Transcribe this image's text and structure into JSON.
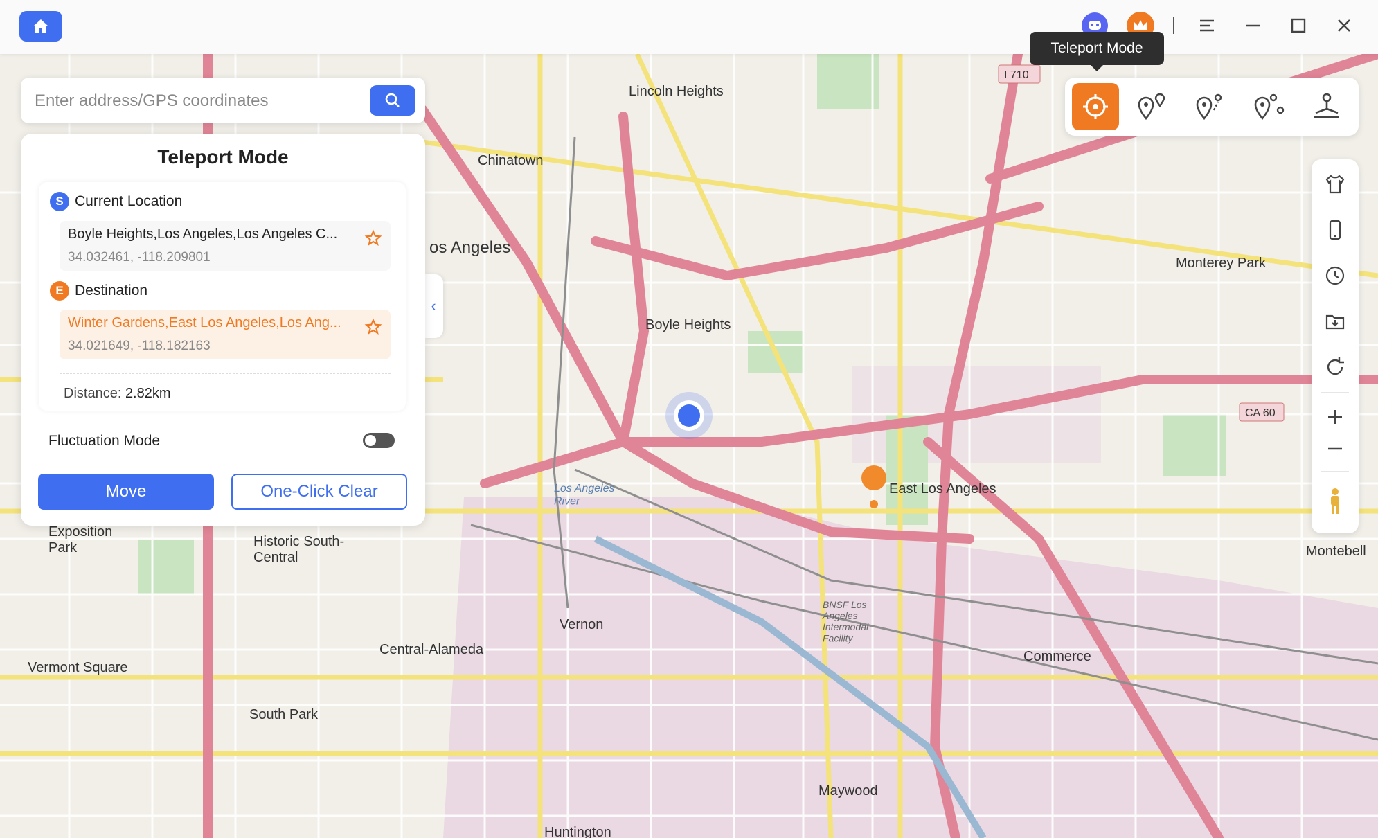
{
  "titlebar": {
    "icons": [
      "home-icon",
      "discord-icon",
      "crown-icon",
      "menu-icon",
      "minimize-icon",
      "maximize-icon",
      "close-icon"
    ]
  },
  "search": {
    "placeholder": "Enter address/GPS coordinates"
  },
  "panel": {
    "title": "Teleport Mode",
    "start_badge": "S",
    "end_badge": "E",
    "current_location_label": "Current Location",
    "current_location_name": "Boyle Heights,Los Angeles,Los Angeles C...",
    "current_location_coords": "34.032461, -118.209801",
    "destination_label": "Destination",
    "destination_name": "Winter Gardens,East Los Angeles,Los Ang...",
    "destination_coords": "34.021649, -118.182163",
    "distance_label": "Distance:",
    "distance_value": "2.82km",
    "fluctuation_label": "Fluctuation Mode",
    "fluctuation_on": false,
    "move_label": "Move",
    "clear_label": "One-Click Clear"
  },
  "modes": {
    "tooltip": "Teleport Mode",
    "items": [
      "teleport-mode-icon",
      "two-spot-mode-icon",
      "multi-spot-mode-icon",
      "jump-teleport-mode-icon",
      "joystick-mode-icon"
    ]
  },
  "right_tools": [
    "shirt-icon",
    "phone-icon",
    "history-icon",
    "import-icon",
    "refresh-icon",
    "zoom-in-icon",
    "zoom-out-icon",
    "street-view-icon"
  ],
  "map": {
    "labels": {
      "lincoln_heights": "Lincoln Heights",
      "chinatown": "Chinatown",
      "los_angeles": "os Angeles",
      "boyle_heights": "Boyle Heights",
      "monterey_park": "Monterey Park",
      "east_los_angeles": "East Los Angeles",
      "historic_south_central": "Historic South-\nCentral",
      "exposition_park": "Exposition\nPark",
      "vermont_square": "Vermont Square",
      "vernon": "Vernon",
      "central_alameda": "Central-Alameda",
      "south_park": "South Park",
      "commerce": "Commerce",
      "montebello": "Montebell",
      "maywood": "Maywood",
      "huntington": "Huntington",
      "bnsf": "BNSF Los\nAngeles\nIntermodal\nFacility",
      "la_river": "Los Angeles\nRiver"
    },
    "shields": {
      "i710": "I 710",
      "ca60": "CA 60"
    }
  }
}
